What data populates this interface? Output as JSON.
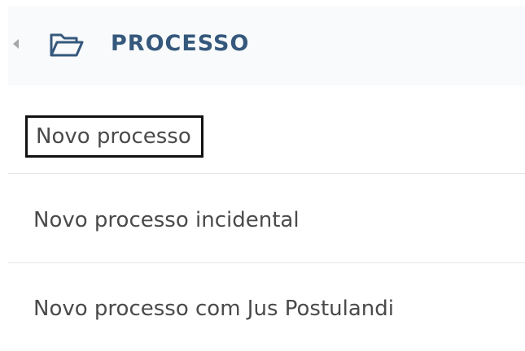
{
  "header": {
    "title": "PROCESSO",
    "back_icon": "chevron-left-icon",
    "folder_icon": "folder-open-icon"
  },
  "menu": {
    "items": [
      {
        "label": "Novo processo"
      },
      {
        "label": "Novo processo incidental"
      },
      {
        "label": "Novo processo com Jus Postulandi"
      }
    ]
  },
  "colors": {
    "header_background": "#f9fafb",
    "title": "#35587c",
    "item_text": "#4a4a4a",
    "divider": "#e6e6e6",
    "focus_outline": "#111111"
  }
}
